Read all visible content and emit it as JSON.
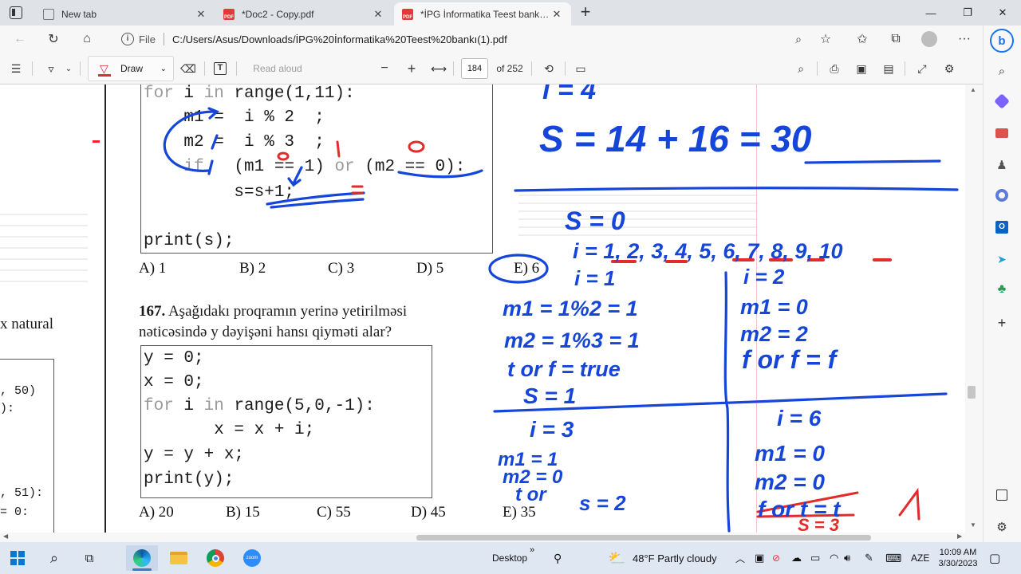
{
  "browser": {
    "tabs": [
      {
        "label": "New tab",
        "icon": "page-icon",
        "active": false
      },
      {
        "label": "*Doc2 - Copy.pdf",
        "icon": "pdf-icon",
        "active": false
      },
      {
        "label": "*İPG İnformatika Teest bankı(1).pdf",
        "icon": "pdf-icon",
        "active": true
      }
    ],
    "new_tab": "+",
    "url_scheme_label": "File",
    "url": "C:/Users/Asus/Downloads/İPG%20İnformatika%20Teest%20bankı(1).pdf"
  },
  "pdf_toolbar": {
    "draw_label": "Draw",
    "read_aloud_label": "Read aloud",
    "zoom_out": "−",
    "zoom_in": "+",
    "page_current": "184",
    "page_total": "of 252"
  },
  "document": {
    "q166": {
      "code_lines": [
        {
          "kw": "for",
          "text": " i ",
          "kw2": "in",
          "rest": " range(1,11):"
        },
        {
          "text": "    m1 =  i % 2  ;"
        },
        {
          "text": "    m2 =  i % 3  ;"
        },
        {
          "kw": "    if",
          "text": "   (m1 == 1) ",
          "kw2": "or",
          "rest": " (m2 == 0):"
        },
        {
          "text": "         s=s+1;"
        },
        {
          "text": "print(s);"
        }
      ],
      "options": [
        "A) 1",
        "B) 2",
        "C) 3",
        "D) 5",
        "E) 6"
      ]
    },
    "q167": {
      "number": "167.",
      "question_line1": "Aşağıdakı proqramın yerinə yetirilməsi",
      "question_line2": "nəticəsində y dəyişəni hansı qiyməti alar?",
      "code_lines": [
        {
          "text": "y = 0;"
        },
        {
          "text": "x = 0;"
        },
        {
          "kw": "for",
          "text": " i ",
          "kw2": "in",
          "rest": " range(5,0,-1):"
        },
        {
          "text": "       x = x + i;"
        },
        {
          "text": "y = y + x;"
        },
        {
          "text": "print(y);"
        }
      ],
      "options": [
        "A) 20",
        "B) 15",
        "C) 55",
        "D) 45",
        "E) 35"
      ]
    },
    "left_fragments": {
      "natural": "x natural",
      "frag1": ", 50)",
      "frag2": "):",
      "frag3": ", 51):",
      "frag4": "= 0:"
    },
    "handwriting": {
      "top_i": "i = 4",
      "sum": "S = 14 + 16 = 30",
      "s0": "S = 0",
      "i_list": "i = 1, 2, 3, 4, 5, 6, 7, 8, 9, 10",
      "c1": [
        "i = 1",
        "m1 = 1%2 = 1",
        "m2 = 1%3 = 1",
        "t or f = true",
        "S = 1"
      ],
      "c2": [
        "i = 2",
        "m1 = 0",
        "m2 = 2",
        "f or f = f"
      ],
      "c3": [
        "i = 3",
        "m1 = 1",
        "m2 = 0",
        "t or",
        "s = 2"
      ],
      "c4": [
        "i = 6",
        "m1 = 0",
        "m2 = 0",
        "f or t = t",
        "S = 3"
      ],
      "annot": {
        "zero_a": "0",
        "one_a": "1",
        "zero_b": "0"
      }
    }
  },
  "taskbar": {
    "desktop_label": "Desktop",
    "weather": "48°F  Partly cloudy",
    "lang": "AZE",
    "time": "10:09 AM",
    "date": "3/30/2023"
  },
  "colors": {
    "ink_blue": "#1646d9",
    "ink_red": "#e22b2b",
    "accent": "#3b78c4"
  }
}
